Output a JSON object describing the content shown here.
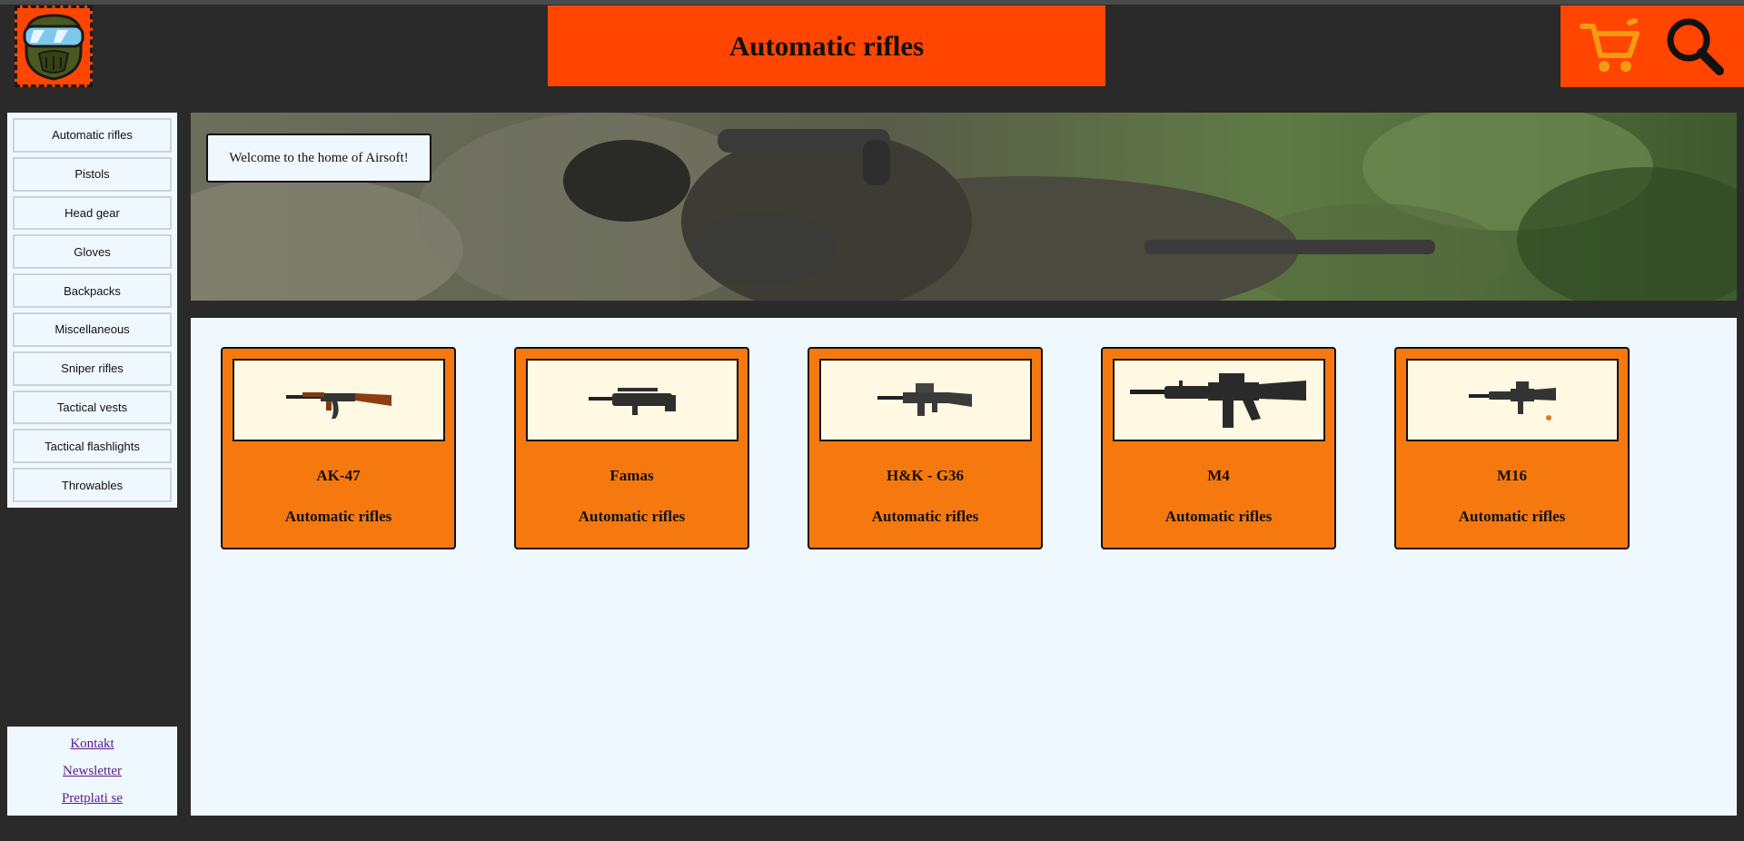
{
  "header": {
    "title": "Automatic rifles",
    "logo_icon": "airsoft-mask-logo-icon",
    "cart_icon": "shopping-cart-icon",
    "search_icon": "search-icon",
    "accent_color": "#ff4500"
  },
  "sidebar": {
    "items": [
      {
        "label": "Automatic rifles"
      },
      {
        "label": "Pistols"
      },
      {
        "label": "Head gear"
      },
      {
        "label": "Gloves"
      },
      {
        "label": "Backpacks"
      },
      {
        "label": "Miscellaneous"
      },
      {
        "label": "Sniper rifles"
      },
      {
        "label": "Tactical vests"
      },
      {
        "label": "Tactical flashlights"
      },
      {
        "label": "Throwables"
      }
    ]
  },
  "footer": {
    "links": [
      {
        "label": "Kontakt"
      },
      {
        "label": "Newsletter"
      },
      {
        "label": "Pretplati se"
      }
    ]
  },
  "banner": {
    "welcome_text": "Welcome to the home of Airsoft!"
  },
  "products": [
    {
      "name": "AK-47",
      "category": "Automatic rifles",
      "icon": "ak47-rifle-icon"
    },
    {
      "name": "Famas",
      "category": "Automatic rifles",
      "icon": "famas-rifle-icon"
    },
    {
      "name": "H&K - G36",
      "category": "Automatic rifles",
      "icon": "g36-rifle-icon"
    },
    {
      "name": "M4",
      "category": "Automatic rifles",
      "icon": "m4-rifle-icon"
    },
    {
      "name": "M16",
      "category": "Automatic rifles",
      "icon": "m16-rifle-icon"
    }
  ]
}
